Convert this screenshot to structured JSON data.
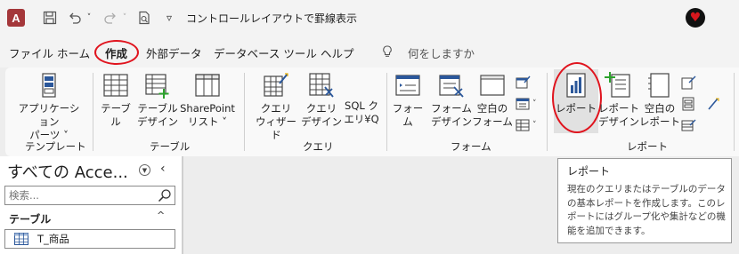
{
  "titlebar": {
    "app_letter": "A",
    "title": "コントロールレイアウトで罫線表示",
    "customize_glyph": "▿"
  },
  "tabs": [
    {
      "label": "ファイル"
    },
    {
      "label": "ホーム"
    },
    {
      "label": "作成",
      "active": true
    },
    {
      "label": "外部データ"
    },
    {
      "label": "データベース ツール"
    },
    {
      "label": "ヘルプ"
    }
  ],
  "tell_me": {
    "label": "何をしますか"
  },
  "ribbon": {
    "templates": {
      "group_label": "テンプレート",
      "app_parts": "アプリケーション\nパーツ ˅"
    },
    "tables": {
      "group_label": "テーブル",
      "table": "テーブル",
      "table_design": "テーブル\nデザイン",
      "sharepoint": "SharePoint\nリスト ˅"
    },
    "queries": {
      "group_label": "クエリ",
      "wizard": "クエリ\nウィザード",
      "design": "クエリ\nデザイン",
      "sql": "SQL ク\nエリ¥Q"
    },
    "forms": {
      "group_label": "フォーム",
      "form": "フォーム",
      "form_design": "フォーム\nデザイン",
      "blank_form": "空白の\nフォーム"
    },
    "reports": {
      "group_label": "レポート",
      "report": "レポート",
      "report_design": "レポート\nデザイン",
      "blank_report": "空白の\nレポート"
    }
  },
  "nav": {
    "title": "すべての Acce...",
    "search_placeholder": "検索...",
    "section": "テーブル",
    "items": [
      {
        "label": "T_商品"
      }
    ]
  },
  "tooltip": {
    "title": "レポート",
    "body": "現在のクエリまたはテーブルのデータの基本レポートを作成します。このレポートにはグループ化や集計などの機能を追加できます。"
  },
  "colors": {
    "accent_red": "#e0141e",
    "access_brand": "#a4373a",
    "icon_blue": "#2b579a"
  }
}
